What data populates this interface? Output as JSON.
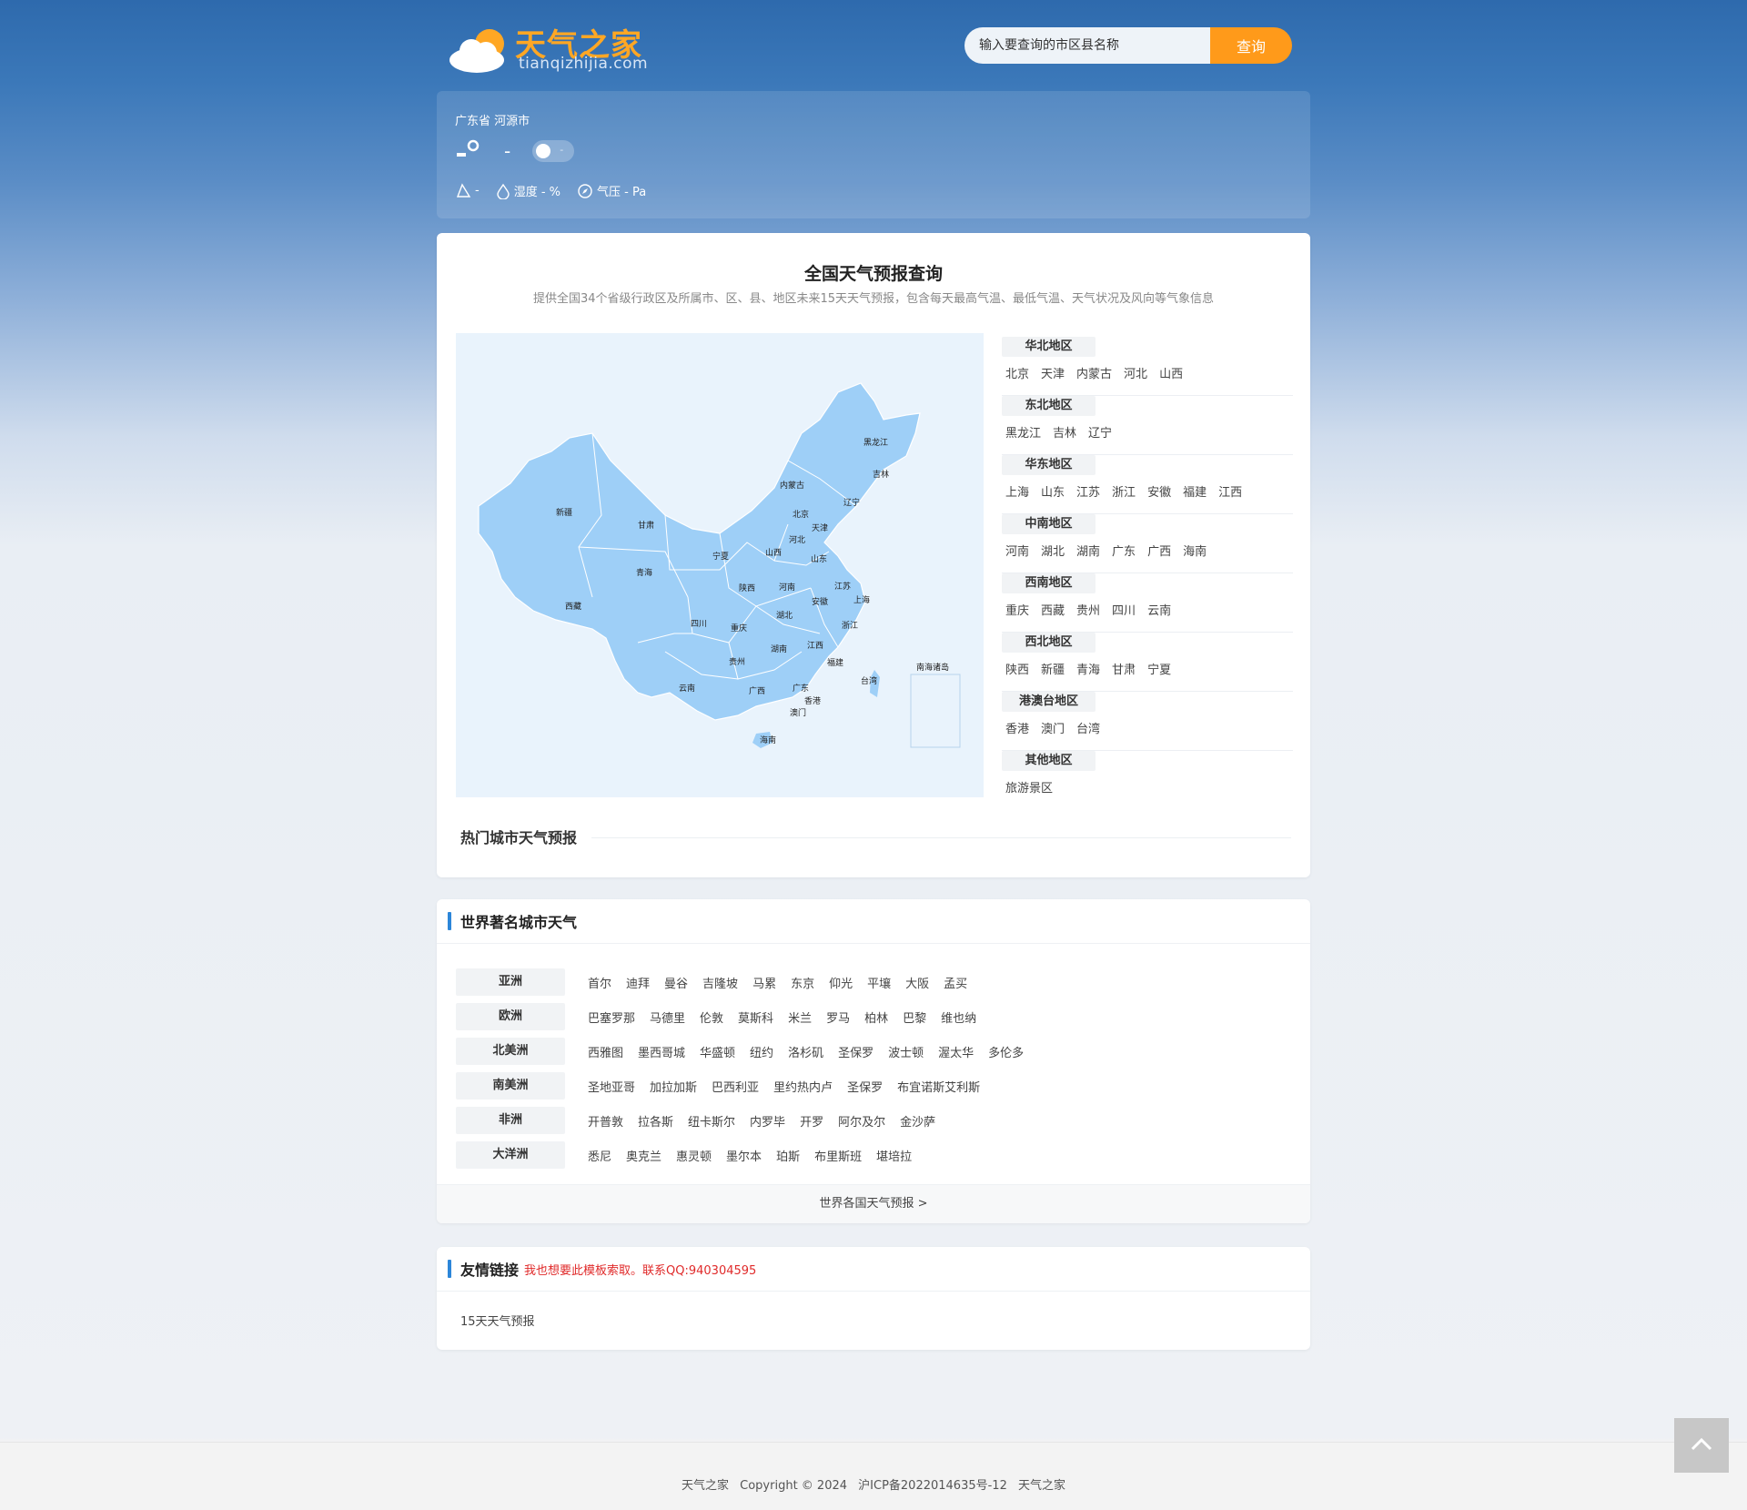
{
  "header": {
    "logo_name": "天气之家",
    "logo_domain": "tianqizhijia.com",
    "search_placeholder": "输入要查询的市区县名称",
    "search_button": "查询"
  },
  "current": {
    "location": "广东省 河源市",
    "temp": "-",
    "toggle_value": "-",
    "wind": "-",
    "humidity": "湿度 - %",
    "pressure": "气压 - Pa"
  },
  "main": {
    "title": "全国天气预报查询",
    "subtitle": "提供全国34个省级行政区及所属市、区、县、地区未来15天天气预报，包含每天最高气温、最低气温、天气状况及风向等气象信息",
    "map_labels": [
      "黑龙江",
      "吉林",
      "辽宁",
      "内蒙古",
      "北京",
      "天津",
      "河北",
      "新疆",
      "甘肃",
      "宁夏",
      "山西",
      "山东",
      "青海",
      "陕西",
      "河南",
      "江苏",
      "安徽",
      "上海",
      "西藏",
      "四川",
      "重庆",
      "湖北",
      "浙江",
      "湖南",
      "江西",
      "贵州",
      "福建",
      "云南",
      "广西",
      "广东",
      "台湾",
      "香港",
      "澳门",
      "海南",
      "南海诸岛"
    ],
    "regions": [
      {
        "name": "华北地区",
        "cities": [
          "北京",
          "天津",
          "内蒙古",
          "河北",
          "山西"
        ]
      },
      {
        "name": "东北地区",
        "cities": [
          "黑龙江",
          "吉林",
          "辽宁"
        ]
      },
      {
        "name": "华东地区",
        "cities": [
          "上海",
          "山东",
          "江苏",
          "浙江",
          "安徽",
          "福建",
          "江西"
        ]
      },
      {
        "name": "中南地区",
        "cities": [
          "河南",
          "湖北",
          "湖南",
          "广东",
          "广西",
          "海南"
        ]
      },
      {
        "name": "西南地区",
        "cities": [
          "重庆",
          "西藏",
          "贵州",
          "四川",
          "云南"
        ]
      },
      {
        "name": "西北地区",
        "cities": [
          "陕西",
          "新疆",
          "青海",
          "甘肃",
          "宁夏"
        ]
      },
      {
        "name": "港澳台地区",
        "cities": [
          "香港",
          "澳门",
          "台湾"
        ]
      },
      {
        "name": "其他地区",
        "cities": [
          "旅游景区"
        ]
      }
    ],
    "hot_title": "热门城市天气预报"
  },
  "world": {
    "title": "世界著名城市天气",
    "continents": [
      {
        "name": "亚洲",
        "cities": [
          "首尔",
          "迪拜",
          "曼谷",
          "吉隆坡",
          "马累",
          "东京",
          "仰光",
          "平壤",
          "大阪",
          "孟买"
        ]
      },
      {
        "name": "欧洲",
        "cities": [
          "巴塞罗那",
          "马德里",
          "伦敦",
          "莫斯科",
          "米兰",
          "罗马",
          "柏林",
          "巴黎",
          "维也纳"
        ]
      },
      {
        "name": "北美洲",
        "cities": [
          "西雅图",
          "墨西哥城",
          "华盛顿",
          "纽约",
          "洛杉矶",
          "圣保罗",
          "波士顿",
          "渥太华",
          "多伦多"
        ]
      },
      {
        "name": "南美洲",
        "cities": [
          "圣地亚哥",
          "加拉加斯",
          "巴西利亚",
          "里约热内卢",
          "圣保罗",
          "布宜诺斯艾利斯"
        ]
      },
      {
        "name": "非洲",
        "cities": [
          "开普敦",
          "拉各斯",
          "纽卡斯尔",
          "内罗毕",
          "开罗",
          "阿尔及尔",
          "金沙萨"
        ]
      },
      {
        "name": "大洋洲",
        "cities": [
          "悉尼",
          "奥克兰",
          "惠灵顿",
          "墨尔本",
          "珀斯",
          "布里斯班",
          "堪培拉"
        ]
      }
    ],
    "more": "世界各国天气预报 >"
  },
  "links": {
    "title": "友情链接",
    "note": "我也想要此模板索取。联系QQ:940304595",
    "items": [
      "15天天气预报"
    ]
  },
  "footer": {
    "site": "天气之家",
    "copyright": "Copyright © 2024",
    "icp": "沪ICP备2022014635号-12",
    "site2": "天气之家"
  },
  "icons": {
    "logo": "cloud-sun-icon",
    "temperature": "thermometer-icon",
    "wind": "wind-icon",
    "humidity": "droplet-icon",
    "pressure": "compass-icon",
    "to_top": "chevron-up-icon"
  },
  "colors": {
    "accent": "#ff9a1a",
    "section_bar": "#2c86d9",
    "map_fill": "#9ecff7",
    "link_note": "#e02a2a"
  }
}
